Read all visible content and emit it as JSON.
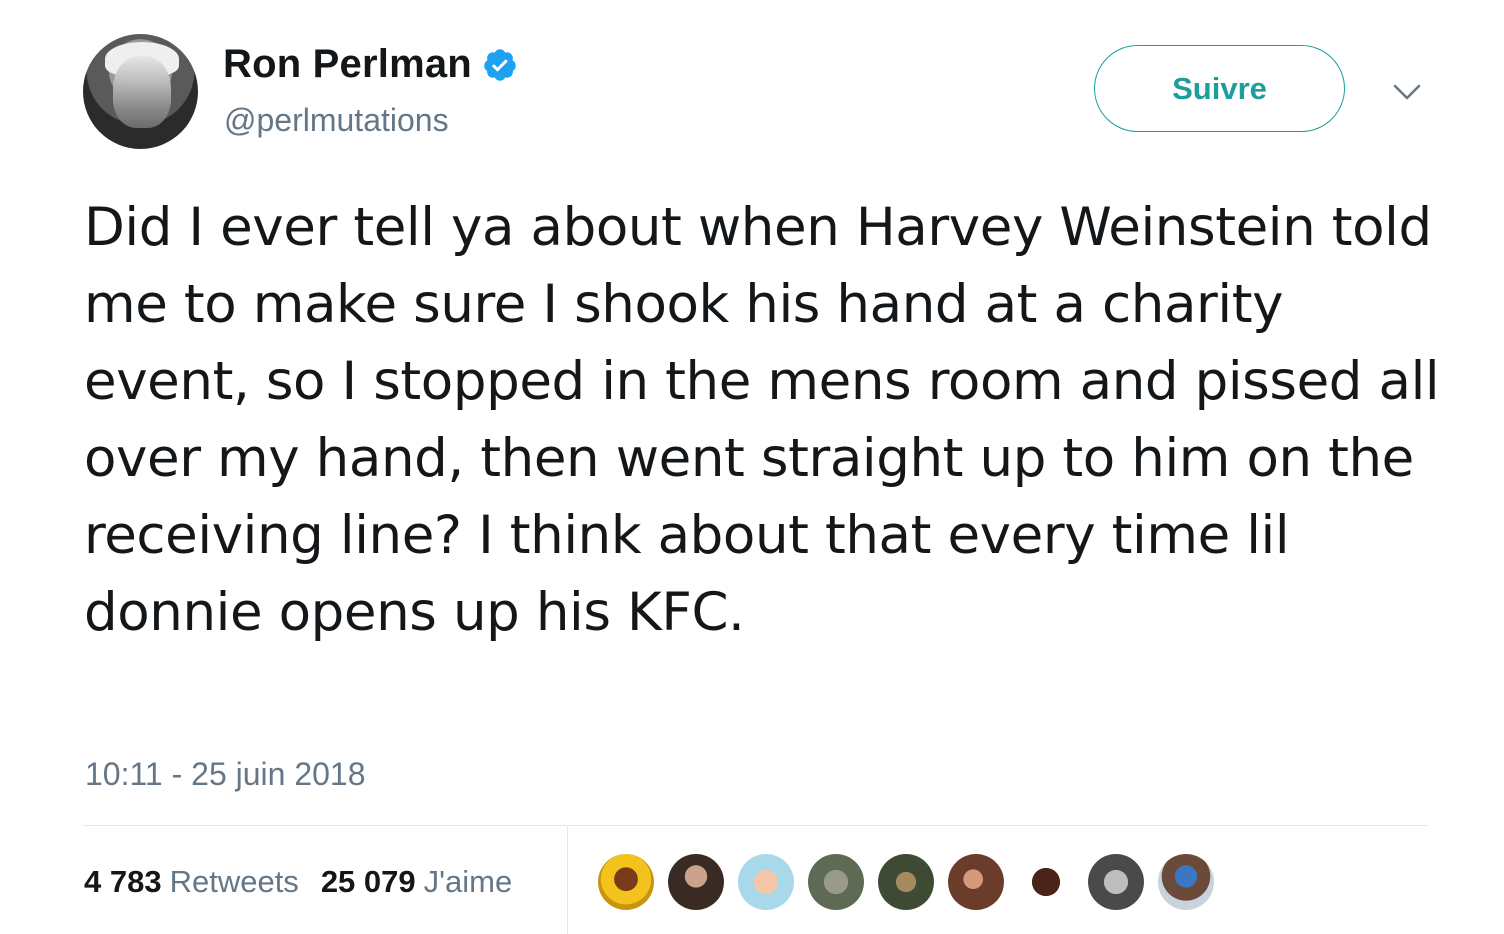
{
  "author": {
    "display_name": "Ron Perlman",
    "handle": "@perlmutations",
    "verified": true,
    "avatar_icon": "profile-photo"
  },
  "actions": {
    "follow_label": "Suivre",
    "menu_icon": "chevron-down-icon"
  },
  "tweet": {
    "text": "Did I ever tell ya about when Harvey Weinstein told me to make sure I shook his hand at a charity event, so I stopped in the mens room and pissed all over my hand, then went straight up to him on the receiving line? I think about that every time lil donnie opens up his KFC.",
    "timestamp": "10:11 - 25 juin 2018"
  },
  "stats": {
    "retweets_count": "4 783",
    "retweets_label": "Retweets",
    "likes_count": "25 079",
    "likes_label": "J'aime"
  },
  "likers": [
    {
      "name": "liker-avatar-1"
    },
    {
      "name": "liker-avatar-2"
    },
    {
      "name": "liker-avatar-3"
    },
    {
      "name": "liker-avatar-4"
    },
    {
      "name": "liker-avatar-5"
    },
    {
      "name": "liker-avatar-6"
    },
    {
      "name": "liker-avatar-7"
    },
    {
      "name": "liker-avatar-8"
    },
    {
      "name": "liker-avatar-9"
    }
  ],
  "colors": {
    "accent": "#1b9e9c",
    "verified": "#1da1f2",
    "secondary_text": "#657786",
    "divider": "#e1e8ed"
  }
}
